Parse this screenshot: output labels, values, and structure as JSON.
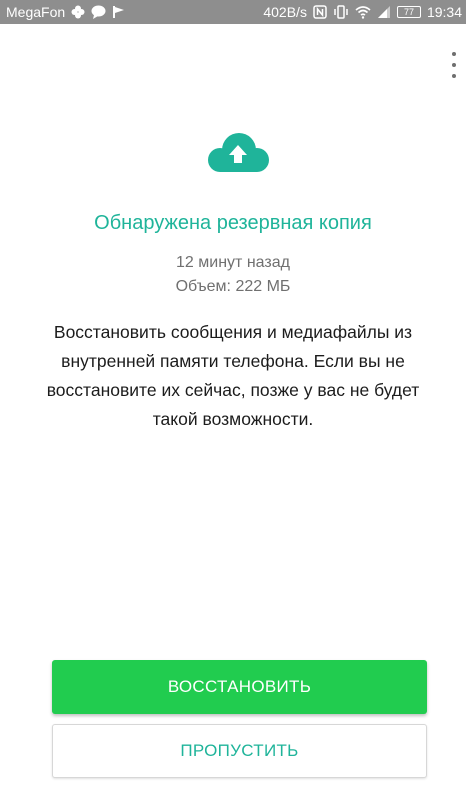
{
  "status_bar": {
    "carrier": "MegaFon",
    "speed": "402B/s",
    "battery": "77",
    "time": "19:34",
    "icons": [
      "clover-icon",
      "chat-bubble-icon",
      "flag-icon",
      "nfc-icon",
      "vibrate-icon",
      "wifi-icon",
      "signal-icon",
      "battery-icon"
    ]
  },
  "backup": {
    "title": "Обнаружена резервная копия",
    "time_ago": "12 минут назад",
    "size": "Объем: 222 МБ",
    "description": "Восстановить сообщения и медиафайлы из внутренней памяти телефона. Если вы не восстановите их сейчас, позже у вас не будет такой возможности."
  },
  "actions": {
    "restore_label": "ВОССТАНОВИТЬ",
    "skip_label": "ПРОПУСТИТЬ"
  },
  "colors": {
    "accent": "#1fb49a",
    "restore_button": "#21cc4f",
    "status_bar": "#8e8e8e"
  }
}
